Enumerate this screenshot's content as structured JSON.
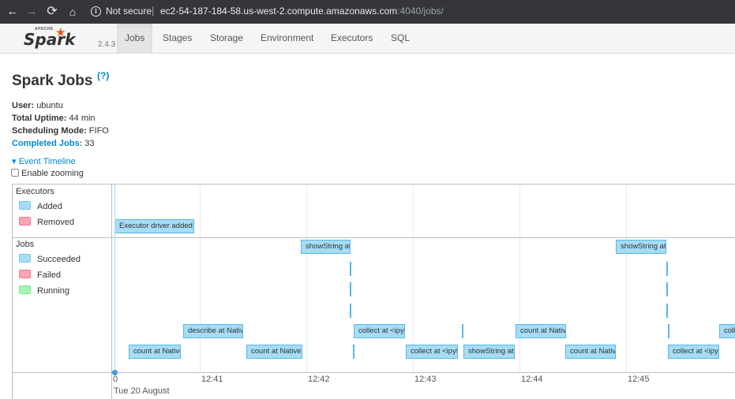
{
  "browser": {
    "back_icon": "←",
    "forward_icon": "→",
    "reload_icon": "⟳",
    "home_icon": "⌂",
    "info_icon": "i",
    "security_label": "Not secure",
    "separator": "|",
    "url_host": "ec2-54-187-184-58.us-west-2.compute.amazonaws.com",
    "url_path": ":4040/jobs/"
  },
  "navbar": {
    "logo_apache": "APACHE",
    "logo_text": "Spark",
    "logo_star": "★",
    "version": "2.4.3",
    "tabs": [
      "Jobs",
      "Stages",
      "Storage",
      "Environment",
      "Executors",
      "SQL"
    ],
    "active_tab": "Jobs"
  },
  "page": {
    "title": "Spark Jobs",
    "help": "(?)"
  },
  "summary": {
    "user_label": "User:",
    "user_value": "ubuntu",
    "uptime_label": "Total Uptime:",
    "uptime_value": "44 min",
    "mode_label": "Scheduling Mode:",
    "mode_value": "FIFO",
    "completed_label": "Completed Jobs:",
    "completed_value": "33"
  },
  "timeline": {
    "toggle_label": "▾ Event Timeline",
    "zoom_label": "Enable zooming",
    "executors_title": "Executors",
    "executor_legend": [
      {
        "label": "Added",
        "color": "#a6dcf5"
      },
      {
        "label": "Removed",
        "color": "#f7a6b4"
      }
    ],
    "jobs_title": "Jobs",
    "job_legend": [
      {
        "label": "Succeeded",
        "color": "#a6dcf5"
      },
      {
        "label": "Failed",
        "color": "#f7a6b4"
      },
      {
        "label": "Running",
        "color": "#a6f5b4"
      }
    ],
    "executor_events": [
      "Executor driver added"
    ],
    "job_items": [
      "showString at",
      "showString at",
      "describe at Nativ",
      "collect at <ipyt",
      "count at Nativ",
      "coll",
      "count at Native",
      "count at Nativel",
      "collect at <ipyt",
      "showString at",
      "count at Nativ",
      "collect at <ipyt"
    ],
    "time_labels": [
      "0",
      "12:41",
      "12:42",
      "12:43",
      "12:44",
      "12:45"
    ],
    "date_label": "Tue 20 August"
  }
}
